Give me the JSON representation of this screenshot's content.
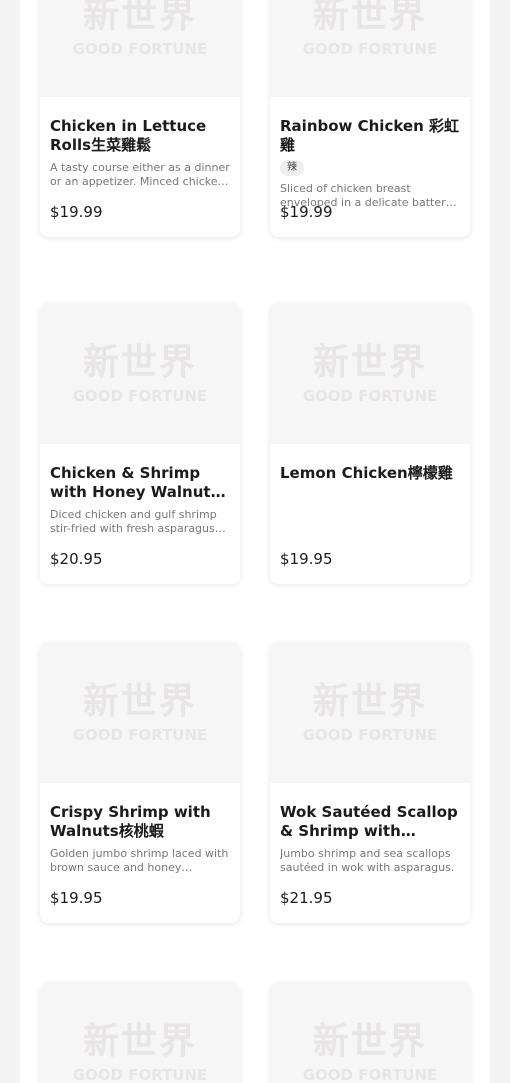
{
  "logo": {
    "cn": "新世界",
    "en": "GOOD FORTUNE"
  },
  "items": [
    {
      "title": "Chicken in Lettuce Rolls生菜雞鬆",
      "desc": "A tasty course either as a dinner or an appetizer. Minced chicken stir-fried with vegetables.",
      "price": "$19.99"
    },
    {
      "title": "Rainbow Chicken 彩虹雞",
      "tag": "辣",
      "desc": "Sliced of chicken breast enveloped in a delicate batter, stir-fried with vegetables.",
      "price": "$19.99"
    },
    {
      "title": "Chicken & Shrimp with Honey Walnuts核桃雞蝦",
      "desc": "Diced chicken and gulf shrimp stir-fried with fresh asparagus and honey walnuts.",
      "price": "$20.95"
    },
    {
      "title": "Lemon Chicken檸檬雞",
      "desc": "",
      "price": "$19.95"
    },
    {
      "title": "Crispy Shrimp with Walnuts核桃蝦",
      "desc": "Golden jumbo shrimp laced with brown sauce and honey walnuts.",
      "price": "$19.95"
    },
    {
      "title": "Wok Sautéed Scallop & Shrimp with Asparagus",
      "desc": "Jumbo shrimp and sea scallops sautéed in wok with asparagus.",
      "price": "$21.95"
    },
    {
      "title": "",
      "desc": "",
      "price": ""
    },
    {
      "title": "",
      "desc": "",
      "price": ""
    }
  ]
}
